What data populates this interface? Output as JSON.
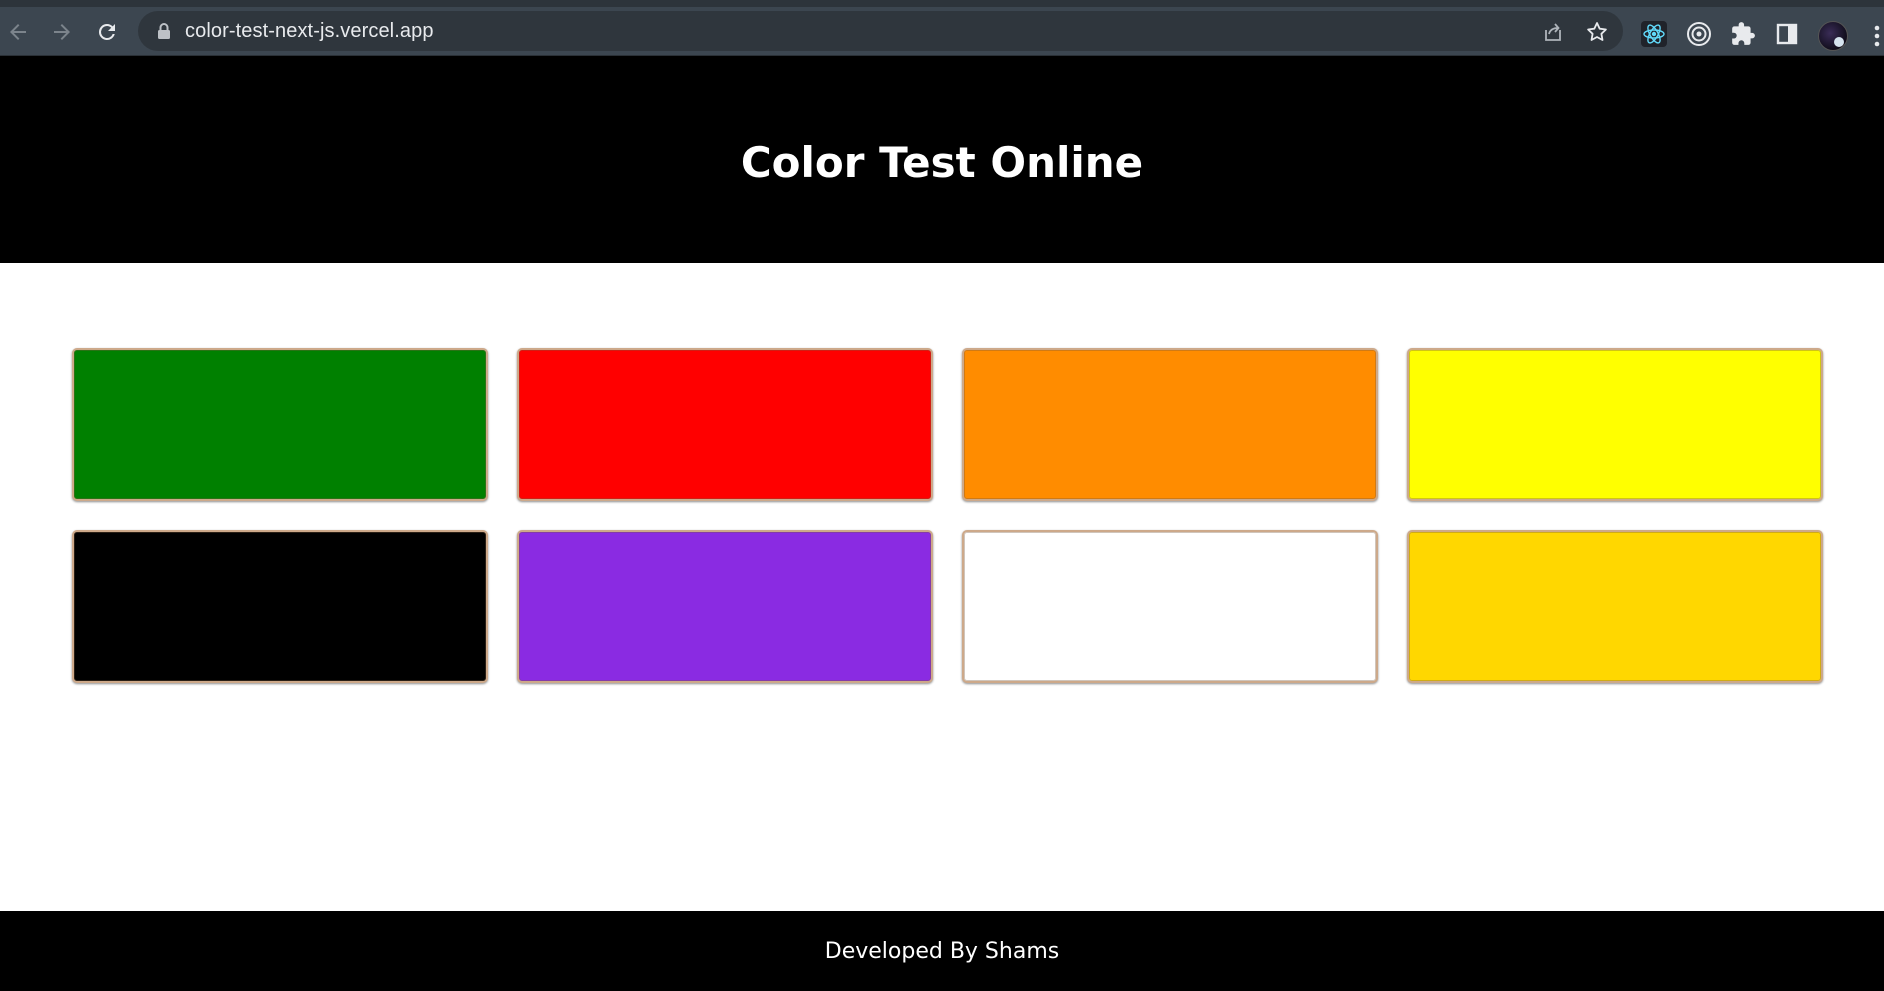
{
  "browser": {
    "url": "color-test-next-js.vercel.app",
    "icons": [
      "back-arrow-icon",
      "forward-arrow-icon",
      "reload-icon",
      "lock-icon",
      "share-icon",
      "star-icon",
      "react-devtools-icon",
      "target-extension-icon",
      "puzzle-extensions-icon",
      "side-panel-icon",
      "profile-avatar",
      "kebab-menu-icon"
    ]
  },
  "header": {
    "title": "Color Test Online"
  },
  "swatches": [
    {
      "name": "green",
      "color": "#008000"
    },
    {
      "name": "red",
      "color": "#ff0000"
    },
    {
      "name": "darkorange",
      "color": "#ff8c00"
    },
    {
      "name": "yellow",
      "color": "#ffff00"
    },
    {
      "name": "black",
      "color": "#000000"
    },
    {
      "name": "blueviolet",
      "color": "#8a2be2"
    },
    {
      "name": "white",
      "color": "#ffffff"
    },
    {
      "name": "gold",
      "color": "#ffd700"
    }
  ],
  "footer": {
    "text": "Developed By Shams"
  },
  "colors": {
    "browser_chrome": "#3c4650",
    "omnibox": "#2f363d",
    "header_bg": "#000000",
    "footer_bg": "#000000",
    "swatch_border": "#cda98a"
  }
}
